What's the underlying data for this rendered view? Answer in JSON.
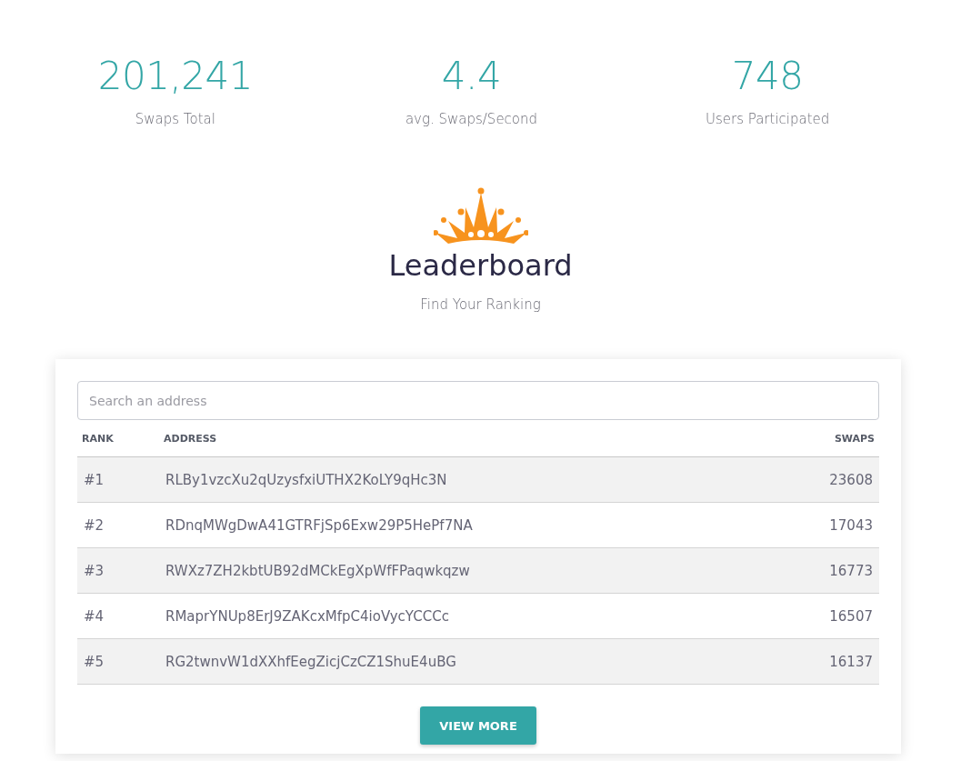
{
  "stats": [
    {
      "value": "201,241",
      "label": "Swaps Total"
    },
    {
      "value": "4.4",
      "label": "avg. Swaps/Second"
    },
    {
      "value": "748",
      "label": "Users Participated"
    }
  ],
  "heading": {
    "title": "Leaderboard",
    "subtitle": "Find Your Ranking"
  },
  "leaderboard": {
    "search": {
      "placeholder": "Search an address"
    },
    "columns": [
      "RANK",
      "ADDRESS",
      "SWAPS"
    ],
    "rows": [
      {
        "rank": "#1",
        "address": "RLBy1vzcXu2qUzysfxiUTHX2KoLY9qHc3N",
        "swaps": "23608"
      },
      {
        "rank": "#2",
        "address": "RDnqMWgDwA41GTRFjSp6Exw29P5HePf7NA",
        "swaps": "17043"
      },
      {
        "rank": "#3",
        "address": "RWXz7ZH2kbtUB92dMCkEgXpWfFPaqwkqzw",
        "swaps": "16773"
      },
      {
        "rank": "#4",
        "address": "RMaprYNUp8ErJ9ZAKcxMfpC4ioVycYCCCc",
        "swaps": "16507"
      },
      {
        "rank": "#5",
        "address": "RG2twnvW1dXXhfEegZicjCzCZ1ShuE4uBG",
        "swaps": "16137"
      }
    ],
    "button": "VIEW MORE"
  }
}
